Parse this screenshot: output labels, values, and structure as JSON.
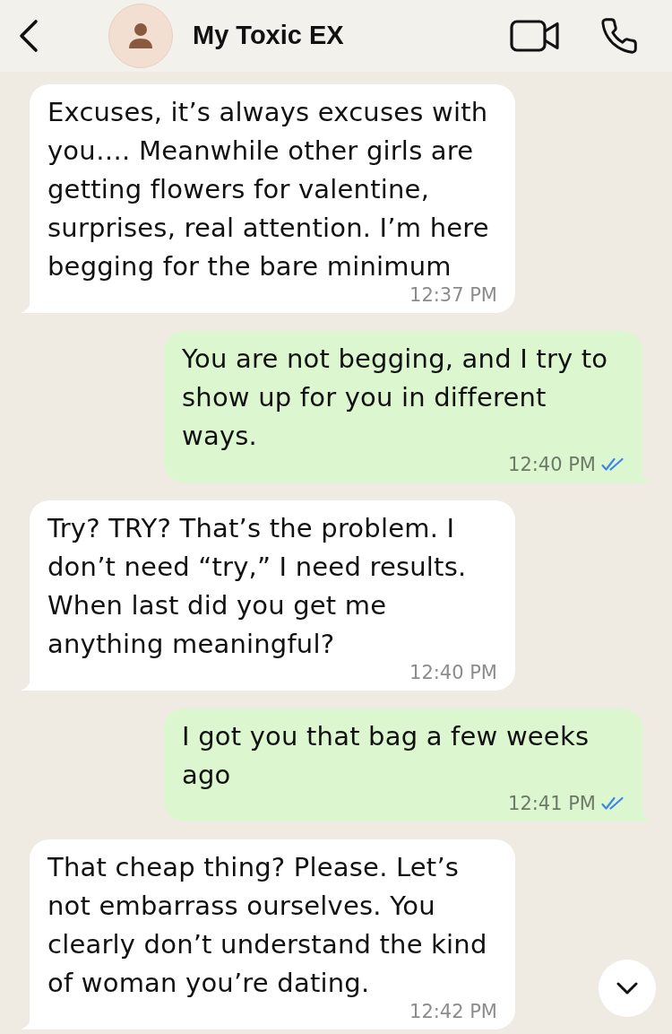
{
  "header": {
    "title": "My Toxic EX"
  },
  "messages": [
    {
      "kind": "incoming",
      "text": "Excuses, it’s always excuses with you…. Meanwhile other girls are getting flowers for valentine, surprises, real attention. I’m here begging for the bare minimum",
      "time": "12:37 PM"
    },
    {
      "kind": "outgoing",
      "text": "You are not begging, and I try to show up for you in different ways.",
      "time": "12:40 PM",
      "read": true
    },
    {
      "kind": "incoming",
      "text": "Try? TRY? That’s the problem. I don’t need “try,” I need results. When last did you get me anything meaningful?",
      "time": "12:40 PM"
    },
    {
      "kind": "outgoing",
      "text": "I got you that bag a few weeks ago",
      "time": "12:41 PM",
      "read": true
    },
    {
      "kind": "incoming",
      "text": "That cheap thing? Please. Let’s not embarrass ourselves. You clearly don’t understand the kind of woman you’re dating.",
      "time": "12:42 PM"
    }
  ]
}
